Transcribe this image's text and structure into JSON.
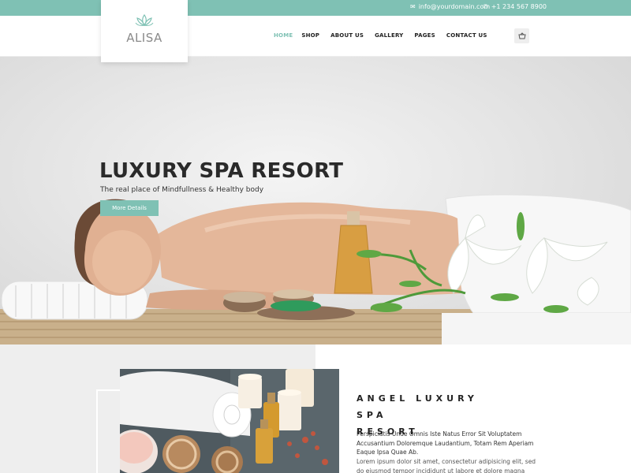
{
  "topbar": {
    "email": "info@yourdomain.com",
    "phone": "+1 234 567 8900",
    "email_icon": "envelope-icon",
    "phone_icon": "phone-icon"
  },
  "brand": {
    "name": "ALISA",
    "logo_icon": "lotus-icon"
  },
  "nav": {
    "items": [
      {
        "label": "HOME",
        "active": true
      },
      {
        "label": "SHOP",
        "active": false
      },
      {
        "label": "ABOUT US",
        "active": false
      },
      {
        "label": "GALLERY",
        "active": false
      },
      {
        "label": "PAGES",
        "active": false
      },
      {
        "label": "CONTACT US",
        "active": false
      }
    ],
    "cart_icon": "basket-icon"
  },
  "hero": {
    "title": "LUXURY SPA RESORT",
    "subtitle": "The real place of Mindfullness & Healthy body",
    "button": "More Details"
  },
  "about": {
    "title_line1": "ANGEL LUXURY SPA",
    "title_line2": "RESORT",
    "paragraph1": "Perspiciatis Unde Omnis Iste Natus Error Sit Voluptatem Accusantium Doloremque Laudantium, Totam Rem Aperiam Eaque Ipsa Quae Ab.",
    "paragraph2": "Lorem ipsum dolor sit amet, consectetur adipisicing elit, sed do eiusmod tempor incididunt ut labore et dolore magna aliqua. Ut enim ad minim"
  },
  "colors": {
    "accent": "#7fc1b4",
    "text_dark": "#222222"
  }
}
